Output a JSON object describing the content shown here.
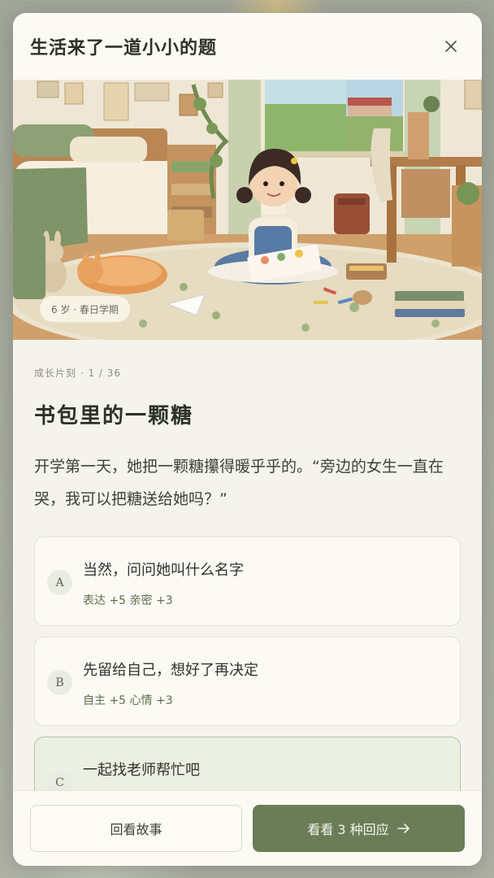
{
  "modal": {
    "title": "生活来了一道小小的题",
    "close_icon": "close-icon"
  },
  "hero": {
    "image": "illustration-girl-drawing-in-bedroom",
    "age_label": "6 岁 · 春日学期"
  },
  "story": {
    "meta": "成长片刻 · 1 / 36",
    "title": "书包里的一颗糖",
    "text": "开学第一天，她把一颗糖攥得暖乎乎的。“旁边的女生一直在哭，我可以把糖送给她吗？”"
  },
  "choices": [
    {
      "letter": "A",
      "text": "当然，问问她叫什么名字",
      "effects": "表达 +5  亲密 +3",
      "selected": false
    },
    {
      "letter": "B",
      "text": "先留给自己，想好了再决定",
      "effects": "自主 +5  心情 +3",
      "selected": false
    },
    {
      "letter": "C",
      "text": "一起找老师帮忙吧",
      "effects": "",
      "selected": true
    }
  ],
  "footer": {
    "back_label": "回看故事",
    "next_label": "看看 3 种回应",
    "next_icon": "arrow-right-icon"
  },
  "colors": {
    "accent": "#6a7d58",
    "selected_bg": "#ebf0e3",
    "effect_text": "#5d6f4d"
  }
}
